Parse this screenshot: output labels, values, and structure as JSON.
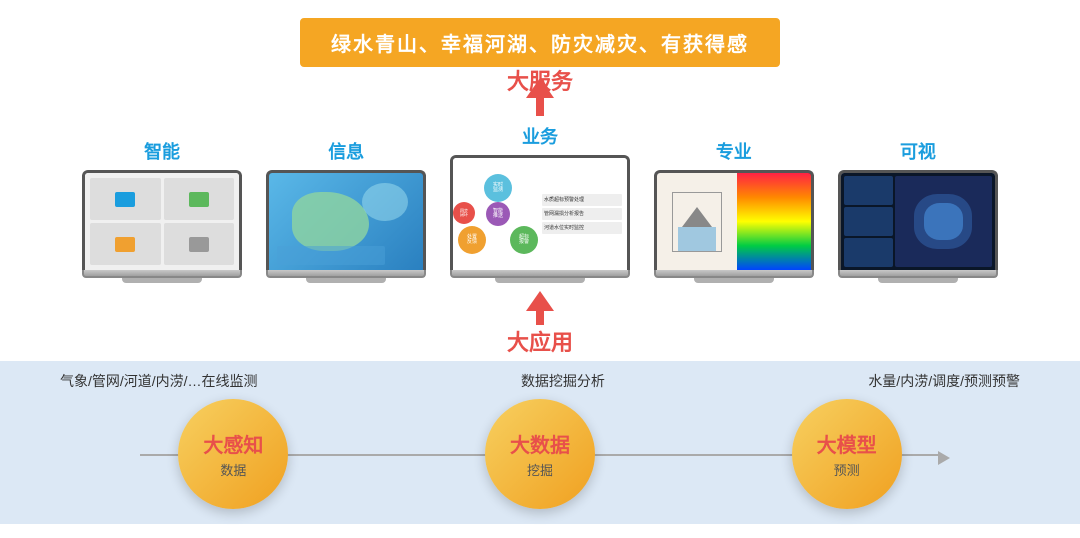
{
  "top": {
    "goal_text": "绿水青山、幸福河湖、防灾减灾、有获得感",
    "big_service_label": "大服务",
    "big_app_label": "大应用"
  },
  "laptops": [
    {
      "label": "智能",
      "screen_type": "smart"
    },
    {
      "label": "信息",
      "screen_type": "info"
    },
    {
      "label": "业务",
      "screen_type": "biz"
    },
    {
      "label": "专业",
      "screen_type": "pro"
    },
    {
      "label": "可视",
      "screen_type": "vis"
    }
  ],
  "bottom": {
    "label1": "气象/管网/河道/内涝/…在线监测",
    "label2": "数据挖掘分析",
    "label3": "水量/内涝/调度/预测预警",
    "circles": [
      {
        "main": "大感知",
        "sub": "数据"
      },
      {
        "main": "大数据",
        "sub": "挖掘"
      },
      {
        "main": "大模型",
        "sub": "预测"
      }
    ]
  }
}
